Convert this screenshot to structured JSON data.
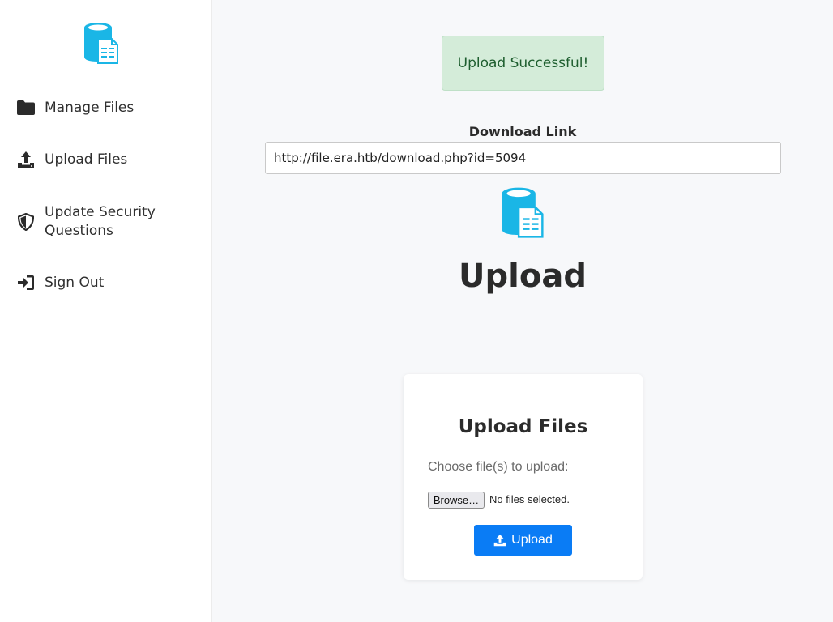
{
  "sidebar": {
    "logo_icon": "database-file-icon",
    "items": [
      {
        "label": "Manage Files",
        "icon": "folder-icon"
      },
      {
        "label": "Upload Files",
        "icon": "upload-icon"
      },
      {
        "label": "Update Security Questions",
        "icon": "shield-icon"
      },
      {
        "label": "Sign Out",
        "icon": "sign-out-icon"
      }
    ]
  },
  "main": {
    "alert": "Upload Successful!",
    "download_label": "Download Link",
    "download_url": "http://file.era.htb/download.php?id=5094",
    "title": "Upload",
    "card": {
      "title": "Upload Files",
      "choose_label": "Choose file(s) to upload:",
      "browse_label": "Browse…",
      "no_files": "No files selected.",
      "upload_label": "Upload"
    }
  },
  "colors": {
    "accent": "#0a7cf5",
    "logo": "#1ab6e6",
    "success_bg": "#d4ecd9",
    "success_text": "#1e5e2f"
  }
}
